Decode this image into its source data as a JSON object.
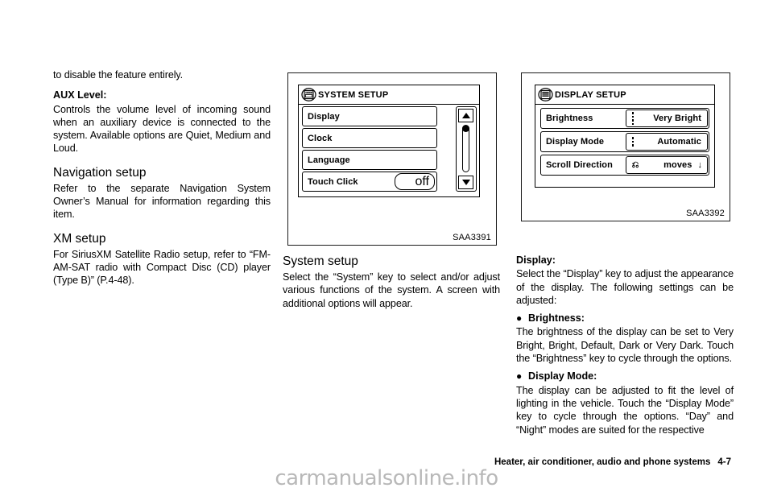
{
  "column_left": {
    "intro_text": "to disable the feature entirely.",
    "aux_heading": "AUX Level:",
    "aux_text": "Controls the volume level of incoming sound when an auxiliary device is connected to the system. Available options are Quiet, Medium and Loud.",
    "nav_heading": "Navigation setup",
    "nav_text": "Refer to the separate Navigation System Owner’s Manual for information regarding this item.",
    "xm_heading": "XM setup",
    "xm_text": "For SiriusXM Satellite Radio setup, refer to “FM-AM-SAT radio with Compact Disc (CD) player (Type B)” (P.4-48)."
  },
  "figure_system": {
    "caption": "SAA3391",
    "icon_name": "system-setup-icon",
    "screen_title": "SYSTEM SETUP",
    "rows": [
      {
        "label": "Display",
        "value": ""
      },
      {
        "label": "Clock",
        "value": ""
      },
      {
        "label": "Language",
        "value": ""
      },
      {
        "label": "Touch Click",
        "value": "off"
      }
    ],
    "scrollbar": {
      "up_icon": "triangle-up-icon",
      "down_icon": "triangle-down-icon"
    }
  },
  "figure_display": {
    "caption": "SAA3392",
    "icon_name": "display-setup-icon",
    "screen_title": "DISPLAY SETUP",
    "rows": [
      {
        "label": "Brightness",
        "value": "Very Bright",
        "marker": "dots"
      },
      {
        "label": "Display Mode",
        "value": "Automatic",
        "marker": "dots"
      },
      {
        "label": "Scroll Direction",
        "value": "moves",
        "marker": "circle-arrow",
        "trailing": "↓"
      }
    ]
  },
  "column_middle": {
    "system_heading": "System setup",
    "system_text": "Select the “System” key to select and/or adjust various functions of the system. A screen with additional options will appear."
  },
  "column_right": {
    "display_heading": "Display:",
    "display_text": "Select the “Display” key to adjust the appearance of the display. The following settings can be adjusted:",
    "bullet1_label": "Brightness:",
    "bullet1_text": "The brightness of the display can be set to Very Bright, Bright, Default, Dark or Very Dark. Touch the “Brightness” key to cycle through the options.",
    "bullet2_label": "Display Mode:",
    "bullet2_text": "The display can be adjusted to fit the level of lighting in the vehicle. Touch the “Display Mode” key to cycle through the options. “Day” and “Night” modes are suited for the respective",
    "bullet_glyph": "●"
  },
  "footer": {
    "chapter_title": "Heater, air conditioner, audio and phone systems",
    "page_number": "4-7",
    "watermark": "carmanualsonline.info"
  },
  "colors": {
    "ink": "#000000",
    "page_background": "#ffffff",
    "watermark": "#b8b8b8"
  }
}
